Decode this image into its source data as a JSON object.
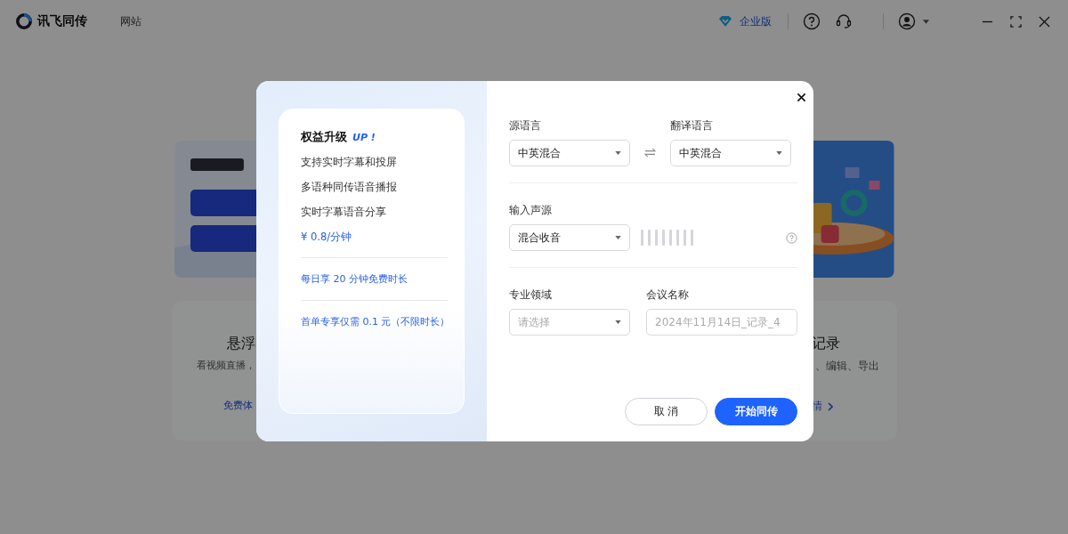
{
  "app": {
    "title": "讯飞同传",
    "nav": [
      {
        "label": "网站"
      }
    ],
    "enterprise": "企业版"
  },
  "background": {
    "cards": [
      {
        "title": "悬浮",
        "desc": "看视频直播，",
        "link": "免费体",
        "kind": "left"
      },
      {
        "title": "记录",
        "desc": "、编辑、导出",
        "link": "情",
        "kind": "right"
      }
    ]
  },
  "dialog": {
    "promo": {
      "title": "权益升级",
      "badge": "UP !",
      "features": [
        "支持实时字幕和投屏",
        "多语种同传语音播报",
        "实时字幕语音分享"
      ],
      "price": "¥ 0.8/分钟",
      "offers": [
        "每日享 20 分钟免费时长",
        "首单专享仅需 0.1 元（不限时长）"
      ]
    },
    "source_language": {
      "label": "源语言",
      "value": "中英混合"
    },
    "target_language": {
      "label": "翻译语言",
      "value": "中英混合"
    },
    "input_source": {
      "label": "输入声源",
      "value": "混合收音"
    },
    "domain": {
      "label": "专业领域",
      "placeholder": "请选择"
    },
    "meeting_name": {
      "label": "会议名称",
      "placeholder": "2024年11月14日_记录_4"
    },
    "buttons": [
      {
        "label": "取 消",
        "kind": "secondary"
      },
      {
        "label": "开始同传",
        "kind": "primary"
      }
    ]
  }
}
